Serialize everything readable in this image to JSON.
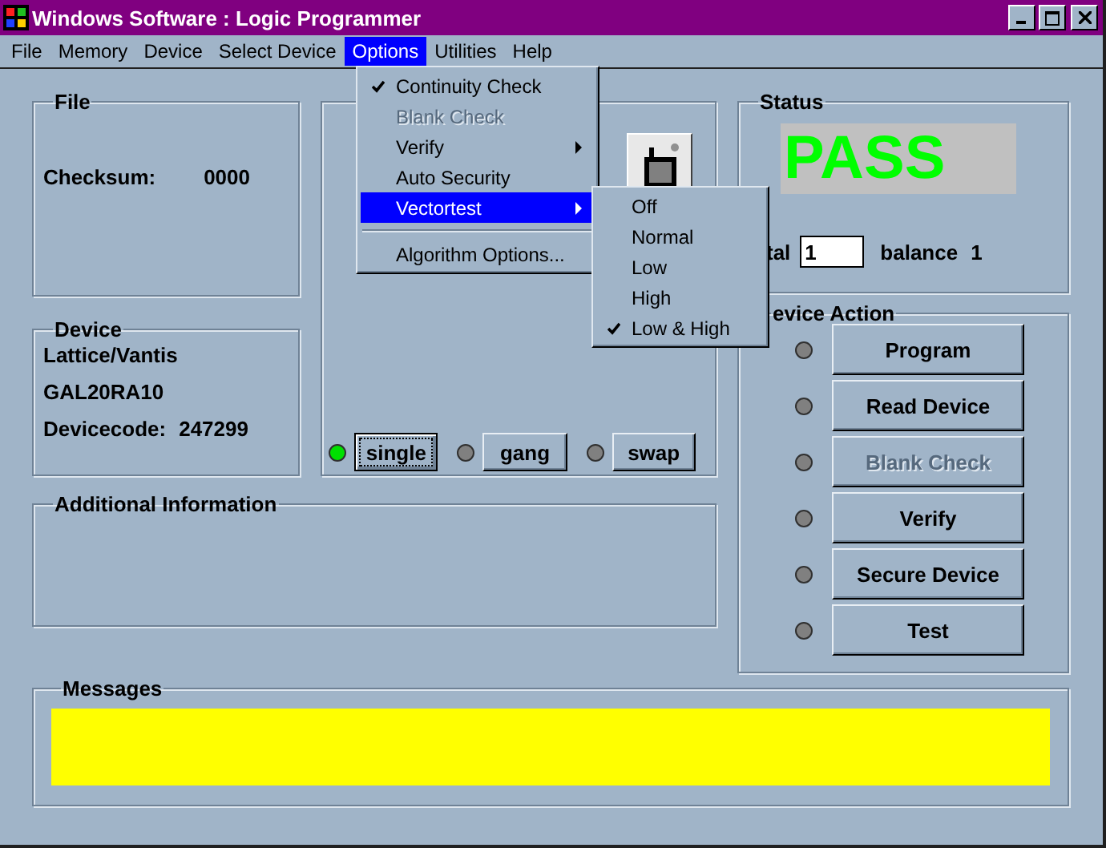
{
  "window": {
    "title": "Windows Software : Logic Programmer"
  },
  "menu_bar": [
    {
      "label": "File",
      "selected": false
    },
    {
      "label": "Memory",
      "selected": false
    },
    {
      "label": "Device",
      "selected": false
    },
    {
      "label": "Select Device",
      "selected": false
    },
    {
      "label": "Options",
      "selected": true
    },
    {
      "label": "Utilities",
      "selected": false
    },
    {
      "label": "Help",
      "selected": false
    }
  ],
  "options_menu": [
    {
      "kind": "item",
      "label": "Continuity Check",
      "checked": true,
      "disabled": false,
      "submenu": false,
      "selected": false
    },
    {
      "kind": "item",
      "label": "Blank Check",
      "checked": false,
      "disabled": true,
      "submenu": false,
      "selected": false
    },
    {
      "kind": "item",
      "label": "Verify",
      "checked": false,
      "disabled": false,
      "submenu": true,
      "selected": false
    },
    {
      "kind": "item",
      "label": "Auto Security",
      "checked": false,
      "disabled": false,
      "submenu": false,
      "selected": false
    },
    {
      "kind": "item",
      "label": "Vectortest",
      "checked": false,
      "disabled": false,
      "submenu": true,
      "selected": true
    },
    {
      "kind": "separator"
    },
    {
      "kind": "item",
      "label": "Algorithm Options...",
      "checked": false,
      "disabled": false,
      "submenu": false,
      "selected": false
    }
  ],
  "vectortest_menu": [
    {
      "label": "Off",
      "checked": false
    },
    {
      "label": "Normal",
      "checked": false
    },
    {
      "label": "Low",
      "checked": false
    },
    {
      "label": "High",
      "checked": false
    },
    {
      "label": "Low & High",
      "checked": true
    }
  ],
  "file_panel": {
    "title": "File",
    "checksum_label": "Checksum:",
    "checksum": "0000"
  },
  "device_panel": {
    "title": "Device",
    "manufacturer": "Lattice/Vantis",
    "part": "GAL20RA10",
    "code_label": "Devicecode:",
    "code": "247299"
  },
  "mode_buttons": [
    {
      "label": "single",
      "selected": true
    },
    {
      "label": "gang",
      "selected": false
    },
    {
      "label": "swap",
      "selected": false
    }
  ],
  "additional_info": {
    "title": "Additional Information"
  },
  "status": {
    "title": "Status",
    "result": "PASS",
    "total_label": "tal",
    "total": "1",
    "balance_label": "balance",
    "balance": "1"
  },
  "device_action": {
    "title": "evice Action",
    "buttons": [
      {
        "label": "Program",
        "disabled": false
      },
      {
        "label": "Read Device",
        "disabled": false
      },
      {
        "label": "Blank Check",
        "disabled": true
      },
      {
        "label": "Verify",
        "disabled": false
      },
      {
        "label": "Secure Device",
        "disabled": false
      },
      {
        "label": "Test",
        "disabled": false
      }
    ]
  },
  "messages": {
    "title": "Messages"
  }
}
